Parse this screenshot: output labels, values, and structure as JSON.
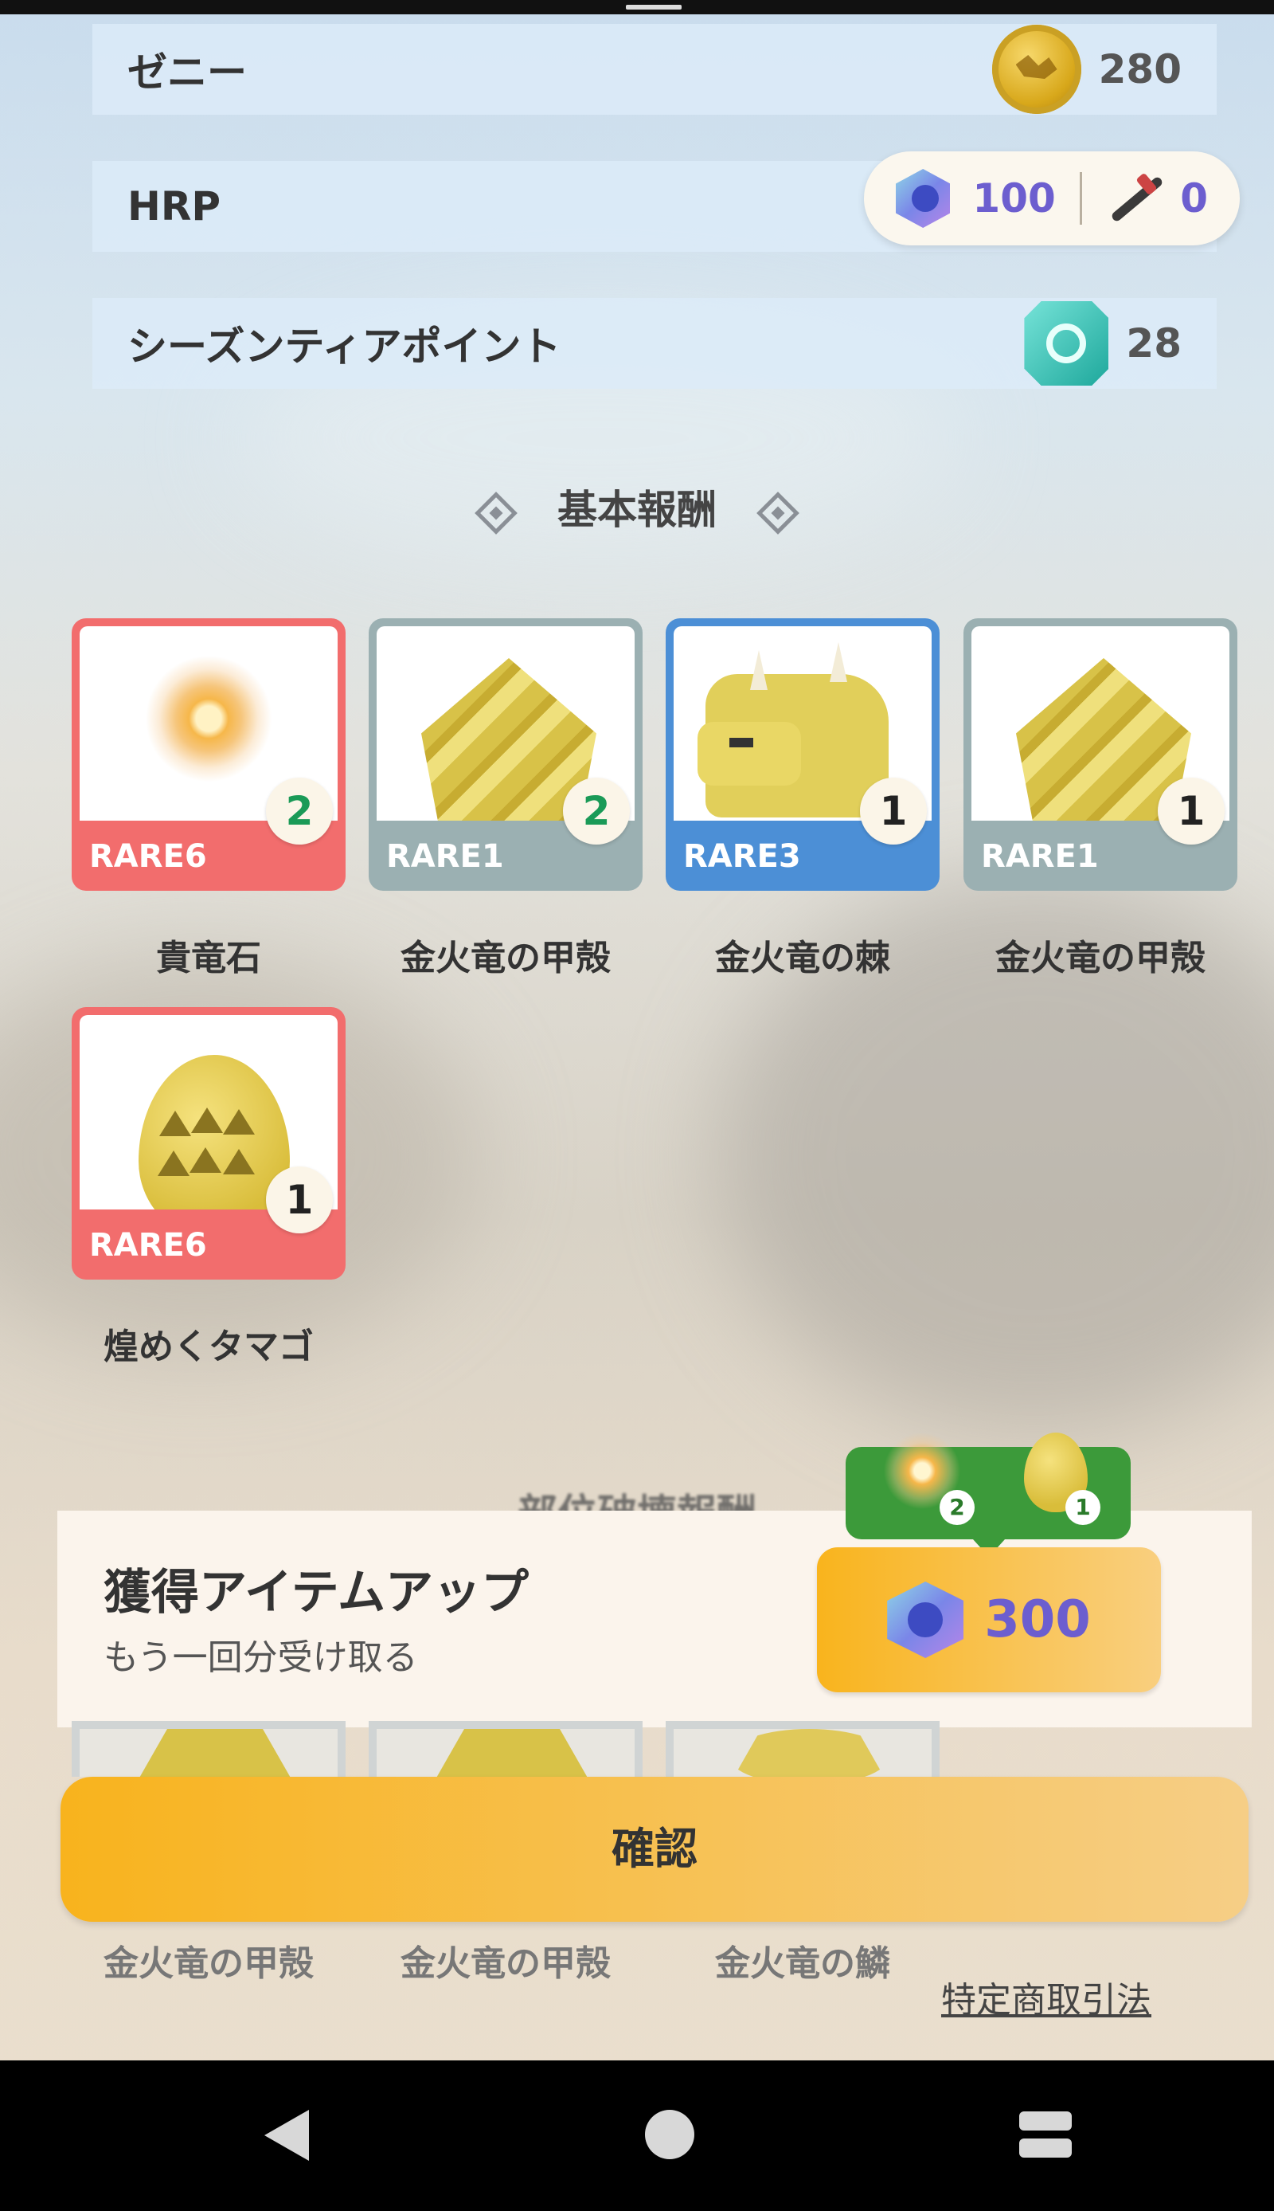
{
  "currency_rows": [
    {
      "label": "ゼニー",
      "value": "280",
      "icon": "zenny-coin-icon"
    },
    {
      "label": "HRP",
      "value": ""
    },
    {
      "label": "シーズンティアポイント",
      "value": "28",
      "icon": "season-tier-icon"
    }
  ],
  "hrp_pill": {
    "hrp_value": "100",
    "weapon_value": "0"
  },
  "basic_rewards": {
    "title": "基本報酬",
    "items": [
      {
        "name": "貴竜石",
        "rarity": "RARE6",
        "count": "2",
        "icon": "dragon-stone-icon"
      },
      {
        "name": "金火竜の甲殻",
        "rarity": "RARE1",
        "count": "2",
        "icon": "shell-icon"
      },
      {
        "name": "金火竜の棘",
        "rarity": "RARE3",
        "count": "1",
        "icon": "spike-icon"
      },
      {
        "name": "金火竜の甲殻",
        "rarity": "RARE1",
        "count": "1",
        "icon": "shell-icon"
      },
      {
        "name": "煌めくタマゴ",
        "rarity": "RARE6",
        "count": "1",
        "icon": "egg-icon"
      }
    ]
  },
  "part_break_title": "部位破壊報酬",
  "upsell": {
    "title": "獲得アイテムアップ",
    "subtitle": "もう一回分受け取る",
    "cost": "300",
    "preview": [
      {
        "count": "2",
        "icon": "dragon-stone-icon"
      },
      {
        "count": "1",
        "icon": "egg-icon"
      }
    ]
  },
  "part_break_items": [
    {
      "name": "金火竜の甲殻"
    },
    {
      "name": "金火竜の甲殻"
    },
    {
      "name": "金火竜の鱗"
    }
  ],
  "confirm_label": "確認",
  "legal_link": "特定商取引法"
}
